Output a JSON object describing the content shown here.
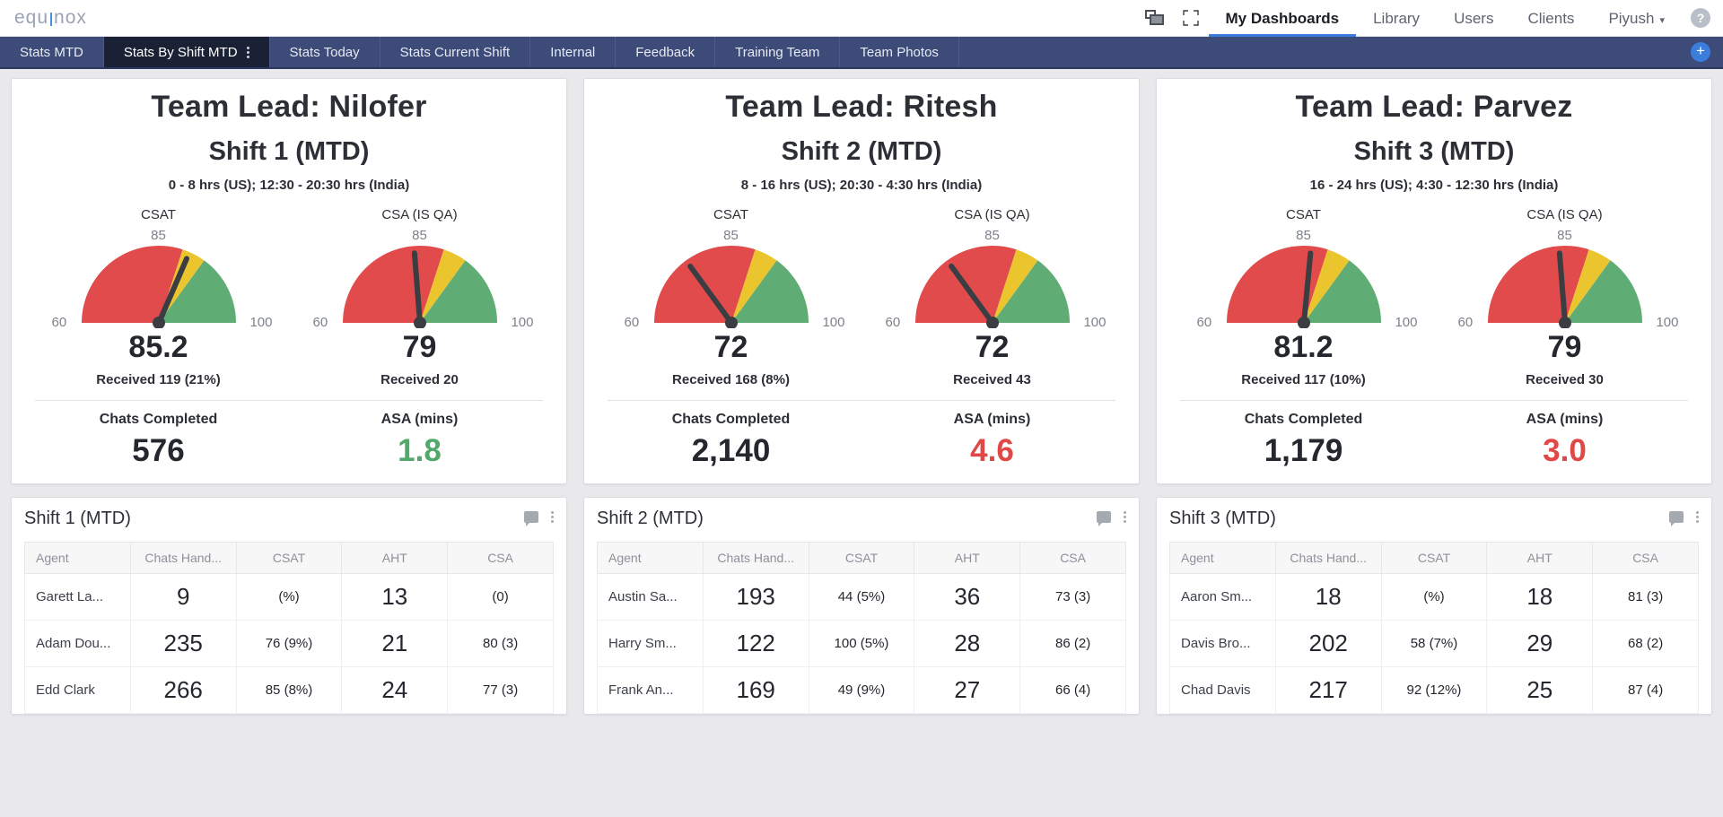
{
  "brand": {
    "name_left": "equ",
    "name_right": "nox"
  },
  "topnav": {
    "icons": [
      {
        "name": "screens-icon",
        "glyph": "screens"
      },
      {
        "name": "expand-icon",
        "glyph": "expand"
      }
    ],
    "links": [
      {
        "label": "My Dashboards",
        "active": true
      },
      {
        "label": "Library",
        "active": false
      },
      {
        "label": "Users",
        "active": false
      },
      {
        "label": "Clients",
        "active": false
      }
    ],
    "user": {
      "label": "Piyush",
      "caret": "▾"
    },
    "help": "?"
  },
  "tabs": [
    {
      "label": "Stats MTD",
      "active": false
    },
    {
      "label": "Stats By Shift MTD",
      "active": true
    },
    {
      "label": "Stats Today",
      "active": false
    },
    {
      "label": "Stats Current Shift",
      "active": false
    },
    {
      "label": "Internal",
      "active": false
    },
    {
      "label": "Feedback",
      "active": false
    },
    {
      "label": "Training Team",
      "active": false
    },
    {
      "label": "Team Photos",
      "active": false
    }
  ],
  "add_tab_label": "+",
  "colors": {
    "gauge_red": "#e14b4b",
    "gauge_yellow": "#ebc52e",
    "gauge_green": "#5fad74",
    "accent": "#3b7ddd",
    "good": "#53a86b",
    "bad": "#e04848",
    "tabstrip": "#3d4b79",
    "tab_active": "#1b2135"
  },
  "kpi_cards": [
    {
      "team_lead": "Team Lead: Nilofer",
      "shift": "Shift 1 (MTD)",
      "hours": "0 - 8 hrs (US); 12:30 - 20:30 hrs (India)",
      "gauges": [
        {
          "label": "CSAT",
          "value": "85.2",
          "received": "Received 119 (21%)",
          "min": "60",
          "target": "85",
          "max": "100",
          "needle_pct": 0.63
        },
        {
          "label": "CSA (IS QA)",
          "value": "79",
          "received": "Received 20",
          "min": "60",
          "target": "85",
          "max": "100",
          "needle_pct": 0.475
        }
      ],
      "metrics": [
        {
          "label": "Chats Completed",
          "value": "576",
          "tone": "normal"
        },
        {
          "label": "ASA (mins)",
          "value": "1.8",
          "tone": "green"
        }
      ]
    },
    {
      "team_lead": "Team Lead: Ritesh",
      "shift": "Shift 2 (MTD)",
      "hours": "8 - 16 hrs (US); 20:30 - 4:30 hrs (India)",
      "gauges": [
        {
          "label": "CSAT",
          "value": "72",
          "received": "Received 168 (8%)",
          "min": "60",
          "target": "85",
          "max": "100",
          "needle_pct": 0.3
        },
        {
          "label": "CSA (IS QA)",
          "value": "72",
          "received": "Received 43",
          "min": "60",
          "target": "85",
          "max": "100",
          "needle_pct": 0.3
        }
      ],
      "metrics": [
        {
          "label": "Chats Completed",
          "value": "2,140",
          "tone": "normal"
        },
        {
          "label": "ASA (mins)",
          "value": "4.6",
          "tone": "red"
        }
      ]
    },
    {
      "team_lead": "Team Lead: Parvez",
      "shift": "Shift 3 (MTD)",
      "hours": "16 - 24 hrs (US); 4:30 - 12:30 hrs (India)",
      "gauges": [
        {
          "label": "CSAT",
          "value": "81.2",
          "received": "Received 117 (10%)",
          "min": "60",
          "target": "85",
          "max": "100",
          "needle_pct": 0.53
        },
        {
          "label": "CSA (IS QA)",
          "value": "79",
          "received": "Received 30",
          "min": "60",
          "target": "85",
          "max": "100",
          "needle_pct": 0.475
        }
      ],
      "metrics": [
        {
          "label": "Chats Completed",
          "value": "1,179",
          "tone": "normal"
        },
        {
          "label": "ASA (mins)",
          "value": "3.0",
          "tone": "red"
        }
      ]
    }
  ],
  "tables": [
    {
      "title": "Shift 1 (MTD)",
      "columns": [
        "Agent",
        "Chats Hand...",
        "CSAT",
        "AHT",
        "CSA"
      ],
      "rows": [
        {
          "agent": "Garett La...",
          "chats": "9",
          "csat": "(%)",
          "csat_tone": "r",
          "aht": "13",
          "csa": "(0)",
          "csa_tone": "r"
        },
        {
          "agent": "Adam Dou...",
          "chats": "235",
          "csat": "76 (9%)",
          "csat_tone": "n",
          "aht": "21",
          "csa": "80 (3)",
          "csa_tone": "g"
        },
        {
          "agent": "Edd Clark",
          "chats": "266",
          "csat": "85 (8%)",
          "csat_tone": "g",
          "aht": "24",
          "csa": "77 (3)",
          "csa_tone": "n"
        }
      ]
    },
    {
      "title": "Shift 2 (MTD)",
      "columns": [
        "Agent",
        "Chats Hand...",
        "CSAT",
        "AHT",
        "CSA"
      ],
      "rows": [
        {
          "agent": "Austin Sa...",
          "chats": "193",
          "csat": "44 (5%)",
          "csat_tone": "r",
          "aht": "36",
          "csa": "73 (3)",
          "csa_tone": "n"
        },
        {
          "agent": "Harry Sm...",
          "chats": "122",
          "csat": "100 (5%)",
          "csat_tone": "g",
          "aht": "28",
          "csa": "86 (2)",
          "csa_tone": "g"
        },
        {
          "agent": "Frank An...",
          "chats": "169",
          "csat": "49 (9%)",
          "csat_tone": "r",
          "aht": "27",
          "csa": "66 (4)",
          "csa_tone": "n"
        }
      ]
    },
    {
      "title": "Shift 3 (MTD)",
      "columns": [
        "Agent",
        "Chats Hand...",
        "CSAT",
        "AHT",
        "CSA"
      ],
      "rows": [
        {
          "agent": "Aaron Sm...",
          "chats": "18",
          "csat": "(%)",
          "csat_tone": "r",
          "aht": "18",
          "csa": "81 (3)",
          "csa_tone": "g"
        },
        {
          "agent": "Davis Bro...",
          "chats": "202",
          "csat": "58 (7%)",
          "csat_tone": "r",
          "aht": "29",
          "csa": "68 (2)",
          "csa_tone": "n"
        },
        {
          "agent": "Chad Davis",
          "chats": "217",
          "csat": "92 (12%)",
          "csat_tone": "g",
          "aht": "25",
          "csa": "87 (4)",
          "csa_tone": "g"
        }
      ]
    }
  ]
}
